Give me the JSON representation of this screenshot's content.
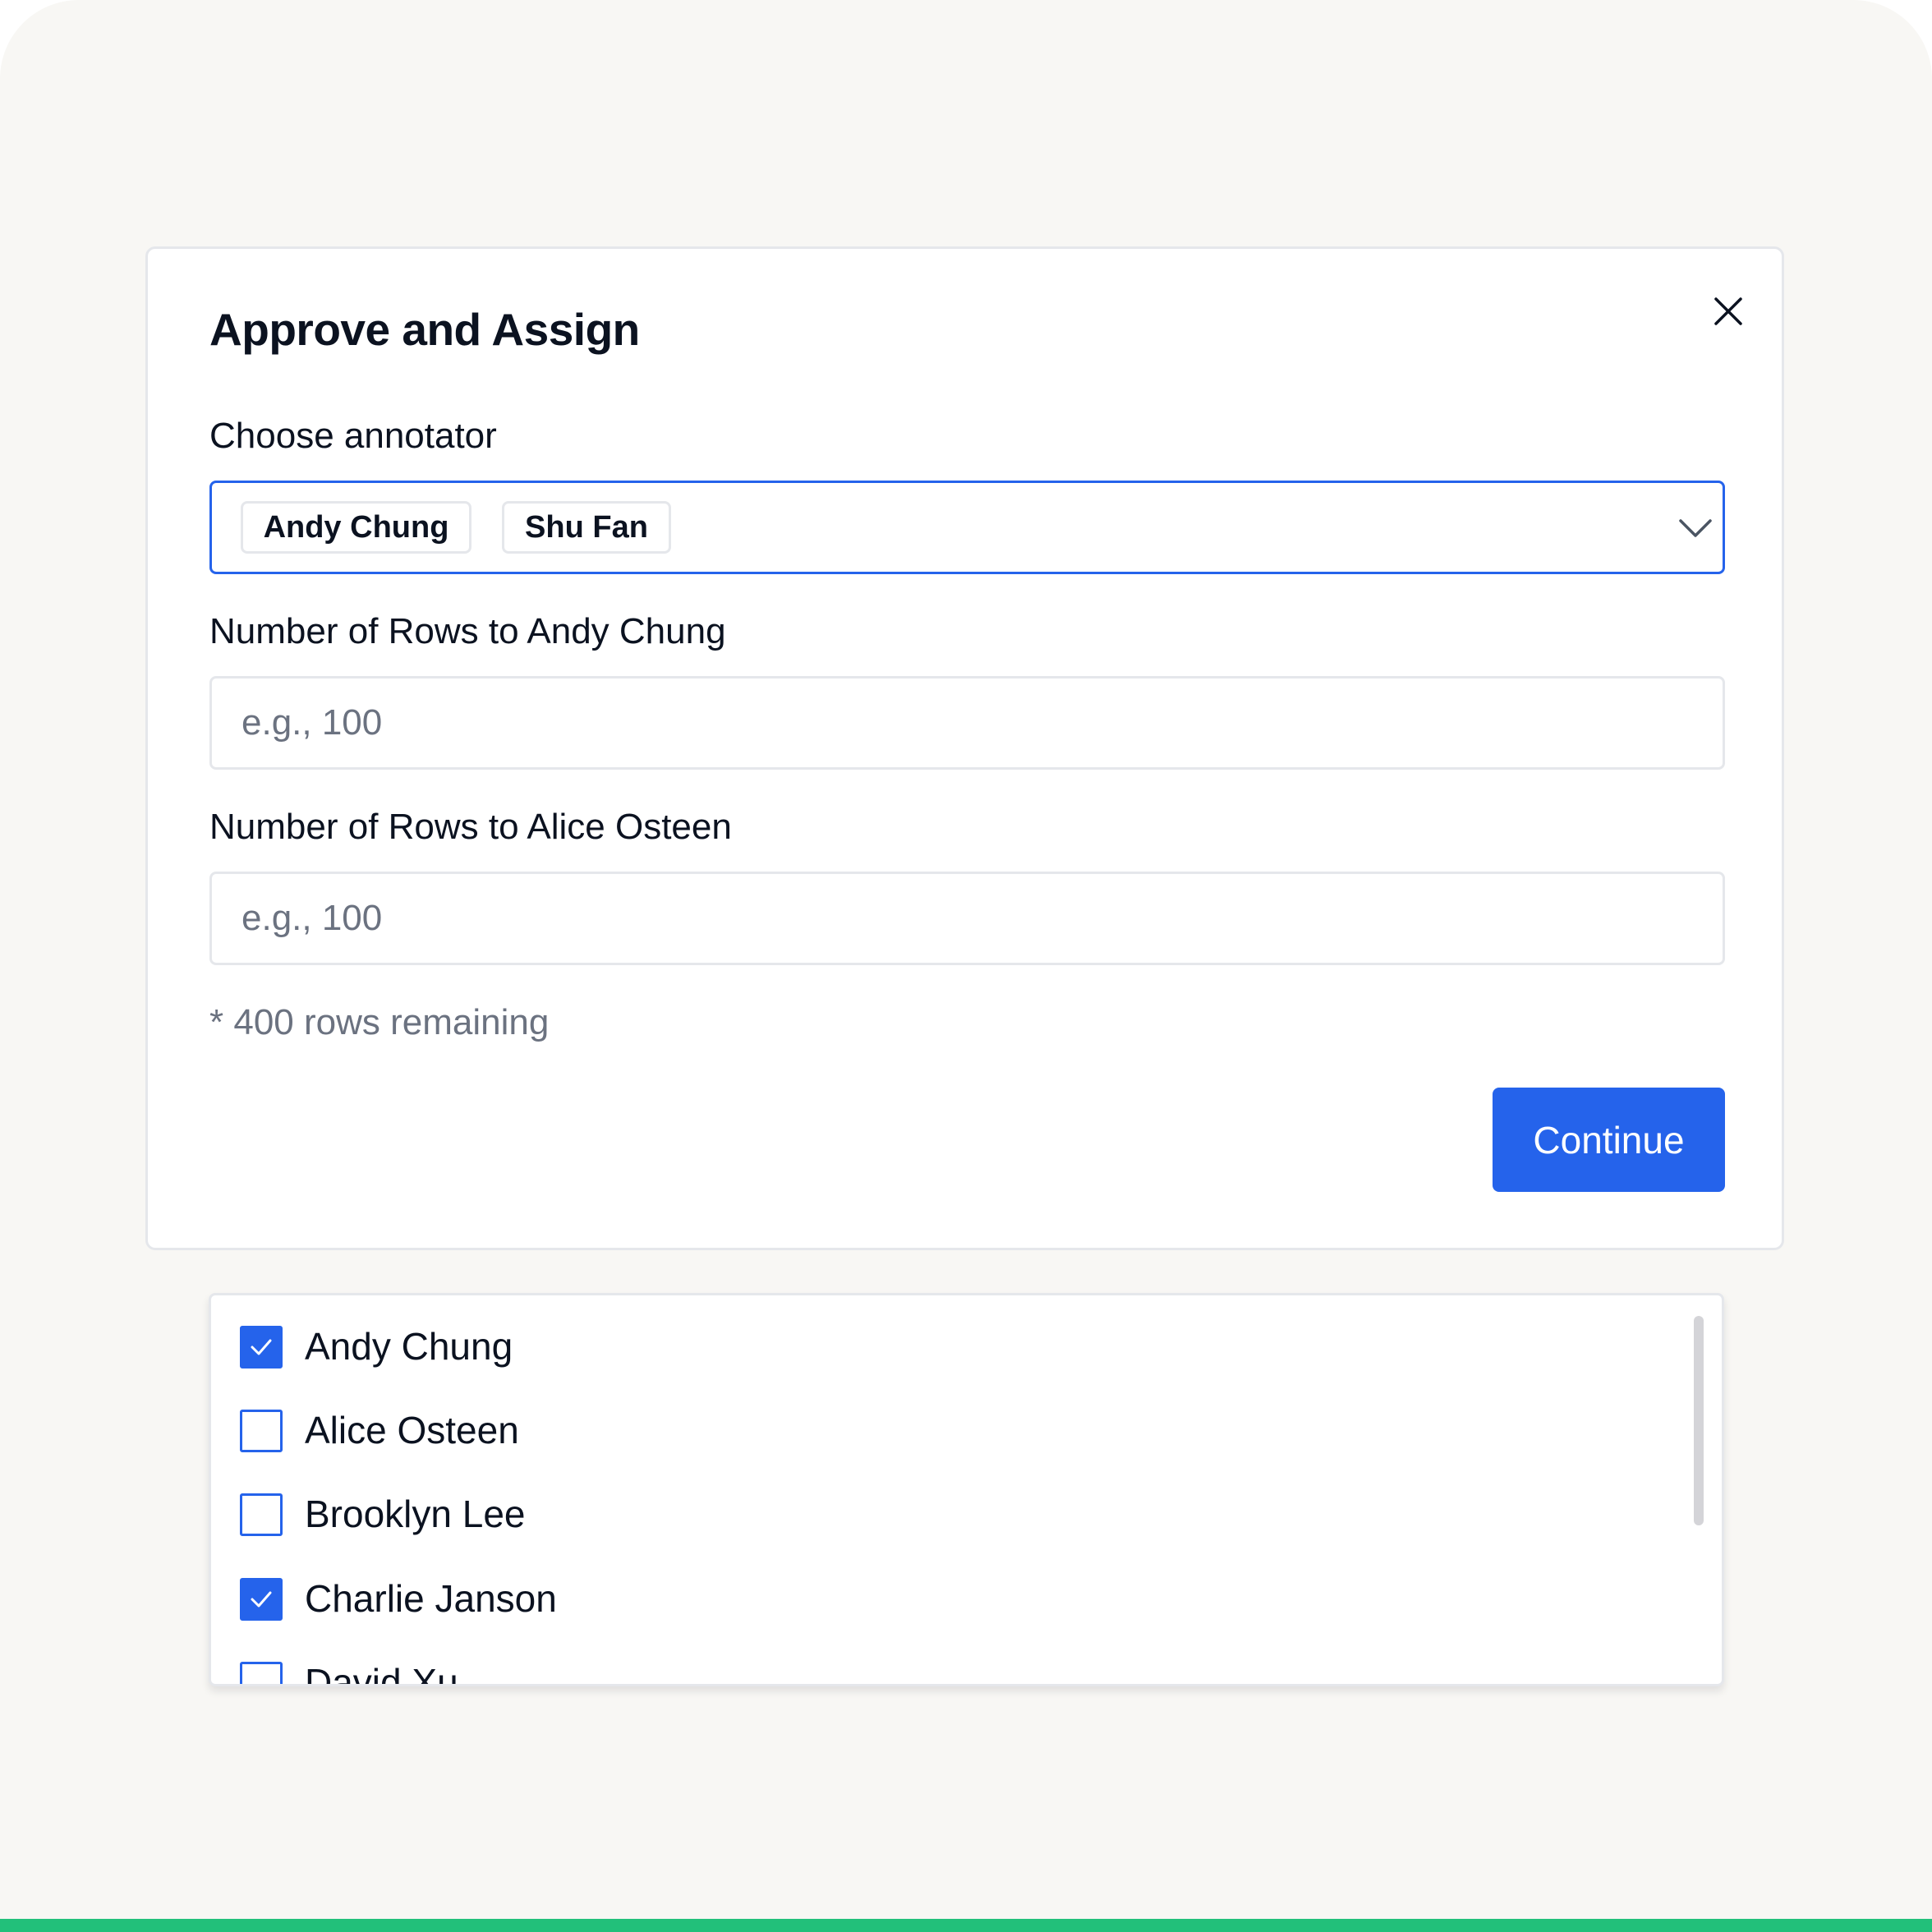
{
  "colors": {
    "background": "#f8f7f4",
    "accent": "#2563eb",
    "bottom_bar": "#22c07a",
    "border": "#e5e7eb",
    "muted_text": "#6b7280"
  },
  "dialog": {
    "title": "Approve and Assign",
    "close_icon": "close-icon",
    "annotator_label": "Choose annotator",
    "selected_annotators": [
      "Andy Chung",
      "Shu Fan"
    ],
    "dropdown_icon": "chevron-down-icon",
    "rows_fields": [
      {
        "label": "Number of Rows to Andy Chung",
        "placeholder": "e.g., 100",
        "value": ""
      },
      {
        "label": "Number of Rows to Alice Osteen",
        "placeholder": "e.g., 100",
        "value": ""
      }
    ],
    "remaining_note": "* 400 rows remaining",
    "continue_label": "Continue"
  },
  "annotator_options": [
    {
      "name": "Andy Chung",
      "checked": true
    },
    {
      "name": "Alice Osteen",
      "checked": false
    },
    {
      "name": "Brooklyn Lee",
      "checked": false
    },
    {
      "name": "Charlie Janson",
      "checked": true
    },
    {
      "name": "David Xu",
      "checked": false
    }
  ]
}
